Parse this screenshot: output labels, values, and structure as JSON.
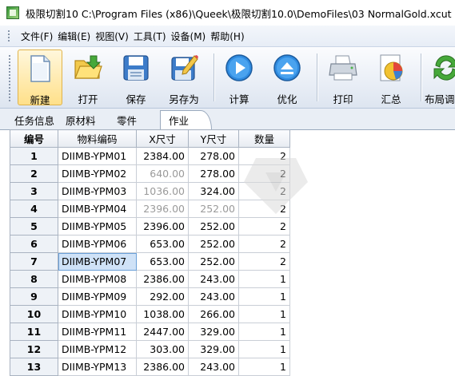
{
  "window": {
    "title": "极限切割10 C:\\Program Files (x86)\\Queek\\极限切割10.0\\DemoFiles\\03 NormalGold.xcut",
    "app_icon": "app-icon"
  },
  "menu": [
    "文件(F)",
    "编辑(E)",
    "视图(V)",
    "工具(T)",
    "设备(M)",
    "帮助(H)"
  ],
  "toolbar": {
    "buttons": [
      {
        "label": "新建",
        "icon": "new-file-icon",
        "active": true
      },
      {
        "label": "打开",
        "icon": "open-folder-icon"
      },
      {
        "label": "保存",
        "icon": "save-icon"
      },
      {
        "label": "另存为",
        "icon": "save-as-icon"
      },
      {
        "label": "计算",
        "icon": "calculate-icon"
      },
      {
        "label": "优化",
        "icon": "optimize-icon"
      },
      {
        "label": "打印",
        "icon": "print-icon"
      },
      {
        "label": "汇总",
        "icon": "summary-icon"
      },
      {
        "label": "布局调",
        "icon": "layout-icon"
      }
    ]
  },
  "tabs": [
    {
      "label": "任务信息"
    },
    {
      "label": "原材料"
    },
    {
      "label": "零件"
    },
    {
      "label": "作业",
      "active": true
    }
  ],
  "grid": {
    "columns": [
      "编号",
      "物料编码",
      "X尺寸",
      "Y尺寸",
      "数量"
    ],
    "rows": [
      [
        "1",
        "DIIMB-YPM01",
        "2384.00",
        "278.00",
        "2"
      ],
      [
        "2",
        "DIIMB-YPM02",
        "640.00",
        "278.00",
        "2"
      ],
      [
        "3",
        "DIIMB-YPM03",
        "1036.00",
        "324.00",
        "2"
      ],
      [
        "4",
        "DIIMB-YPM04",
        "2396.00",
        "252.00",
        "2"
      ],
      [
        "5",
        "DIIMB-YPM05",
        "2396.00",
        "252.00",
        "2"
      ],
      [
        "6",
        "DIIMB-YPM06",
        "653.00",
        "252.00",
        "2"
      ],
      [
        "7",
        "DIIMB-YPM07",
        "653.00",
        "252.00",
        "2"
      ],
      [
        "8",
        "DIIMB-YPM08",
        "2386.00",
        "243.00",
        "1"
      ],
      [
        "9",
        "DIIMB-YPM09",
        "292.00",
        "243.00",
        "1"
      ],
      [
        "10",
        "DIIMB-YPM10",
        "1038.00",
        "266.00",
        "1"
      ],
      [
        "11",
        "DIIMB-YPM11",
        "2447.00",
        "329.00",
        "1"
      ],
      [
        "12",
        "DIIMB-YPM12",
        "303.00",
        "329.00",
        "1"
      ],
      [
        "13",
        "DIIMB-YPM13",
        "2386.00",
        "243.00",
        "1"
      ]
    ],
    "selected_cell": "DIIMB-YPM07"
  }
}
